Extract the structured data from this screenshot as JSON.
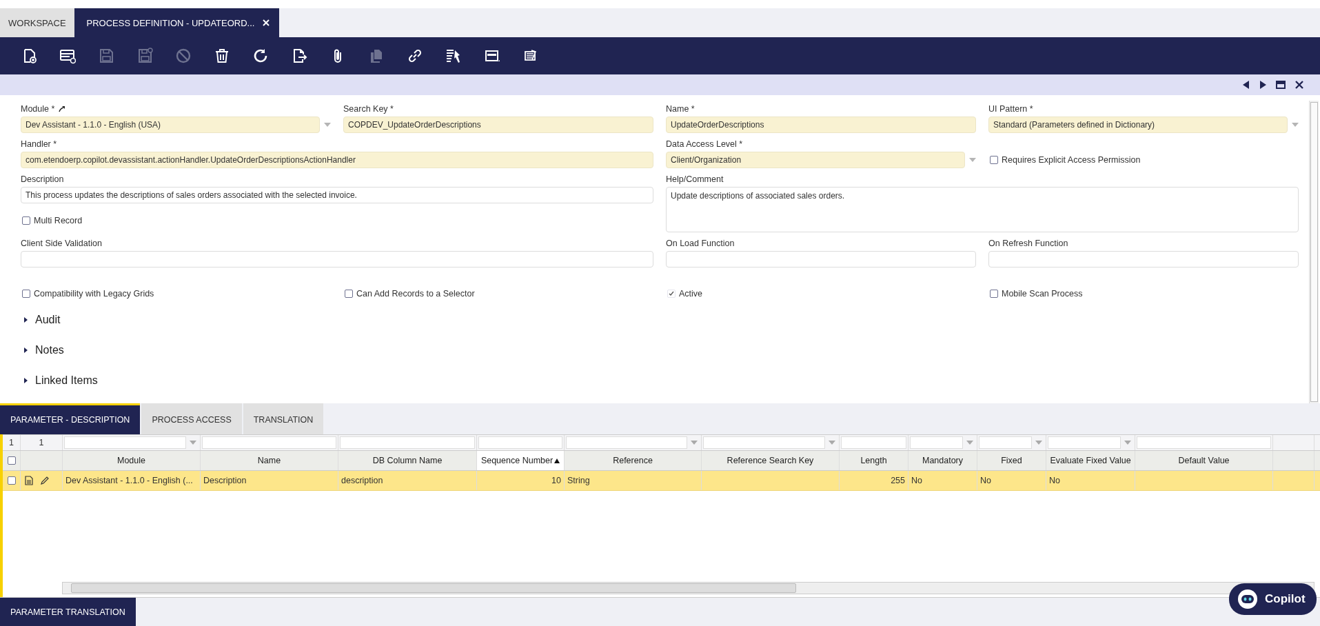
{
  "tabs": [
    {
      "label": "WORKSPACE",
      "selected": false,
      "closable": false
    },
    {
      "label": "PROCESS DEFINITION - UPDATEORD...",
      "selected": true,
      "closable": true
    }
  ],
  "toolbar": [
    {
      "kind": "new-document",
      "disabled": false
    },
    {
      "kind": "new-row",
      "disabled": false
    },
    {
      "kind": "save",
      "disabled": true
    },
    {
      "kind": "save-close",
      "disabled": true
    },
    {
      "kind": "cancel",
      "disabled": true
    },
    {
      "kind": "delete",
      "disabled": false
    },
    {
      "kind": "refresh",
      "disabled": false
    },
    {
      "kind": "export",
      "disabled": false
    },
    {
      "kind": "attach",
      "disabled": false
    },
    {
      "kind": "clone",
      "disabled": true
    },
    {
      "kind": "link",
      "disabled": false
    },
    {
      "kind": "tools",
      "disabled": false
    },
    {
      "kind": "grid-view",
      "disabled": false
    },
    {
      "kind": "form-view",
      "disabled": false
    }
  ],
  "form": {
    "fields": [
      {
        "kind": "select",
        "label": "Module *",
        "required": true,
        "link": true,
        "value": "Dev Assistant - 1.1.0 - English (USA)"
      },
      {
        "kind": "text",
        "label": "Search Key *",
        "required": true,
        "value": "COPDEV_UpdateOrderDescriptions"
      },
      {
        "kind": "text",
        "label": "Name *",
        "required": true,
        "value": "UpdateOrderDescriptions"
      },
      {
        "kind": "select",
        "label": "UI Pattern *",
        "required": true,
        "value": "Standard (Parameters defined in Dictionary)"
      },
      {
        "kind": "text",
        "label": "Handler *",
        "required": true,
        "value": "com.etendoerp.copilot.devassistant.actionHandler.UpdateOrderDescriptionsActionHandler"
      },
      {
        "kind": "select",
        "label": "Data Access Level *",
        "required": true,
        "value": "Client/Organization"
      },
      {
        "kind": "checkbox",
        "label": "Requires Explicit Access Permission",
        "checked": false
      },
      {
        "kind": "text",
        "label": "Description",
        "required": false,
        "value": "This process updates the descriptions of sales orders associated with the selected invoice."
      },
      {
        "kind": "textarea",
        "label": "Help/Comment",
        "required": false,
        "value": "Update descriptions of associated sales orders."
      },
      {
        "kind": "checkbox",
        "label": "Multi Record",
        "checked": false
      },
      {
        "kind": "text",
        "label": "Client Side Validation",
        "required": false
      },
      {
        "kind": "text",
        "label": "On Load Function",
        "required": false
      },
      {
        "kind": "text",
        "label": "On Refresh Function",
        "required": false
      },
      {
        "kind": "checkbox",
        "label": "Compatibility with Legacy Grids",
        "checked": false
      },
      {
        "kind": "checkbox",
        "label": "Can Add Records to a Selector",
        "checked": false
      },
      {
        "kind": "checkbox",
        "label": "Active",
        "checked": true
      },
      {
        "kind": "checkbox",
        "label": "Mobile Scan Process",
        "checked": false
      }
    ],
    "sections": [
      {
        "label": "Audit",
        "expanded": false
      },
      {
        "label": "Notes",
        "expanded": false
      },
      {
        "label": "Linked Items",
        "expanded": false
      }
    ]
  },
  "subtabs": [
    {
      "label": "PARAMETER - DESCRIPTION",
      "selected": true
    },
    {
      "label": "PROCESS ACCESS",
      "selected": false
    },
    {
      "label": "TRANSLATION",
      "selected": false
    }
  ],
  "grid": {
    "counts": [
      "1",
      "1"
    ],
    "all_checked": false,
    "columns": [
      {
        "name": "Module",
        "filter_dropdown": true,
        "sorted": false
      },
      {
        "name": "Name",
        "filter_dropdown": false,
        "sorted": false
      },
      {
        "name": "DB Column Name",
        "filter_dropdown": false,
        "sorted": false
      },
      {
        "name": "Sequence Number",
        "filter_dropdown": false,
        "sorted": true
      },
      {
        "name": "Reference",
        "filter_dropdown": true,
        "sorted": false
      },
      {
        "name": "Reference Search Key",
        "filter_dropdown": true,
        "sorted": false
      },
      {
        "name": "Length",
        "filter_dropdown": false,
        "sorted": false
      },
      {
        "name": "Mandatory",
        "filter_dropdown": true,
        "sorted": false
      },
      {
        "name": "Fixed",
        "filter_dropdown": true,
        "sorted": false
      },
      {
        "name": "Evaluate Fixed Value",
        "filter_dropdown": true,
        "sorted": false
      },
      {
        "name": "Default Value",
        "filter_dropdown": false,
        "sorted": false
      }
    ],
    "rows": [
      {
        "selected": true,
        "checked": false,
        "cells": [
          "Dev Assistant - 1.1.0 - English (...",
          "Description",
          "description",
          "10",
          "String",
          null,
          "255",
          "No",
          "No",
          "No",
          null
        ]
      }
    ]
  },
  "bottom_tabs": [
    {
      "label": "PARAMETER TRANSLATION",
      "selected": true
    }
  ],
  "copilot": {
    "label": "Copilot"
  }
}
